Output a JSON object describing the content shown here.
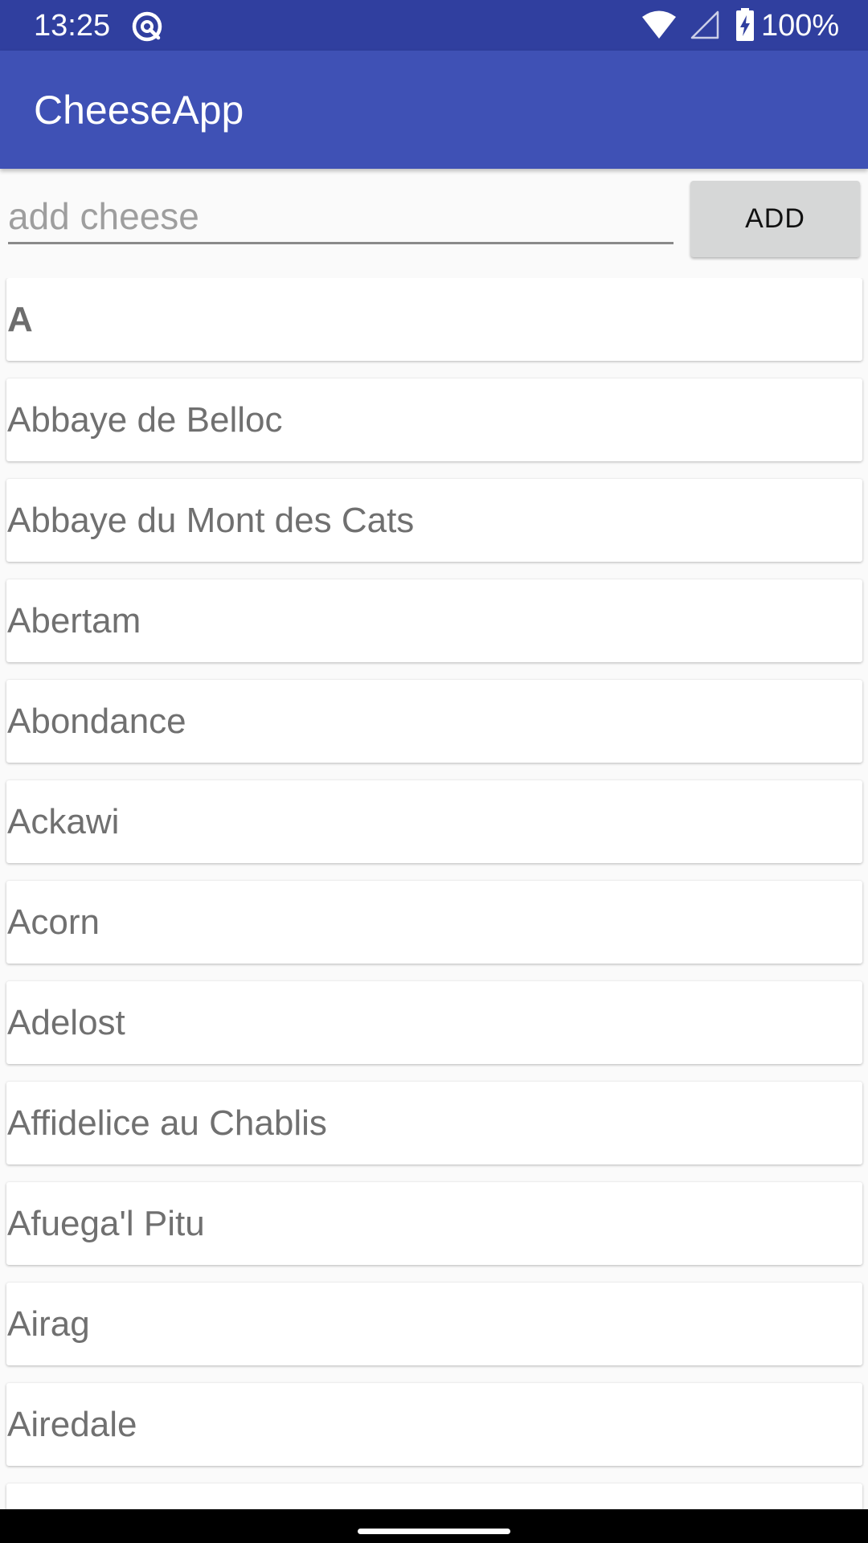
{
  "status_bar": {
    "time": "13:25",
    "battery_level": "100%",
    "icons": [
      "app-notification-icon",
      "wifi-icon",
      "signal-icon",
      "battery-charging-icon"
    ]
  },
  "app_bar": {
    "title": "CheeseApp",
    "color": "#3f51b5",
    "status_color": "#303f9f"
  },
  "input_row": {
    "placeholder": "add cheese",
    "value": "",
    "add_label": "ADD"
  },
  "list": {
    "items": [
      {
        "label": "A",
        "is_header": true
      },
      {
        "label": "Abbaye de Belloc",
        "is_header": false
      },
      {
        "label": "Abbaye du Mont des Cats",
        "is_header": false
      },
      {
        "label": "Abertam",
        "is_header": false
      },
      {
        "label": "Abondance",
        "is_header": false
      },
      {
        "label": "Ackawi",
        "is_header": false
      },
      {
        "label": "Acorn",
        "is_header": false
      },
      {
        "label": "Adelost",
        "is_header": false
      },
      {
        "label": "Affidelice au Chablis",
        "is_header": false
      },
      {
        "label": "Afuega'l Pitu",
        "is_header": false
      },
      {
        "label": "Airag",
        "is_header": false
      },
      {
        "label": "Airedale",
        "is_header": false
      },
      {
        "label": "",
        "is_header": false
      }
    ]
  },
  "nav_bar": {
    "handle_icon": "gesture-handle"
  }
}
